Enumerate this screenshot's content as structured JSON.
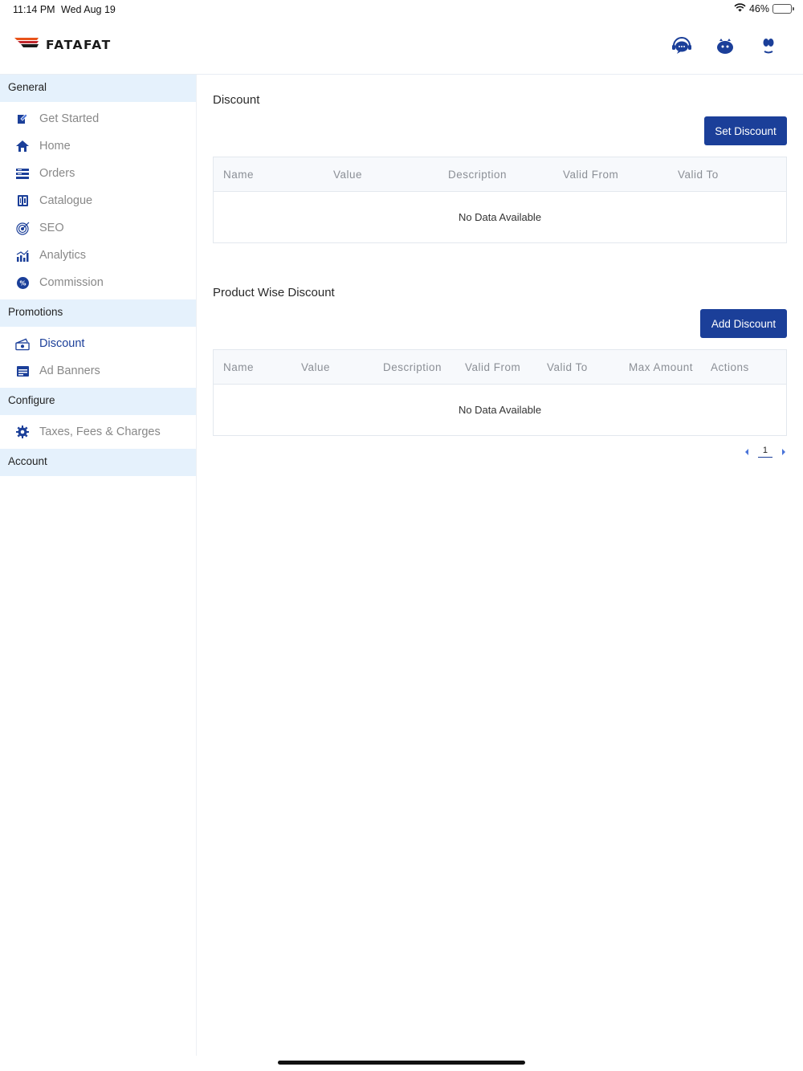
{
  "status_bar": {
    "time": "11:14 PM",
    "date": "Wed Aug 19",
    "battery": "46%",
    "battery_level": 0.46
  },
  "header": {
    "logo_text": "FATAFAT",
    "icons": [
      "chat-support-icon",
      "bot-icon",
      "user-icon"
    ]
  },
  "sidebar": {
    "sections": [
      {
        "title": "General",
        "items": [
          {
            "label": "Get Started",
            "icon": "edit-icon"
          },
          {
            "label": "Home",
            "icon": "home-icon"
          },
          {
            "label": "Orders",
            "icon": "orders-icon"
          },
          {
            "label": "Catalogue",
            "icon": "catalogue-icon"
          },
          {
            "label": "SEO",
            "icon": "target-icon"
          },
          {
            "label": "Analytics",
            "icon": "analytics-icon"
          },
          {
            "label": "Commission",
            "icon": "percent-icon"
          }
        ]
      },
      {
        "title": "Promotions",
        "items": [
          {
            "label": "Discount",
            "icon": "discount-icon",
            "active": true
          },
          {
            "label": "Ad Banners",
            "icon": "banner-icon"
          }
        ]
      },
      {
        "title": "Configure",
        "items": [
          {
            "label": "Taxes, Fees & Charges",
            "icon": "settings-gear-icon"
          }
        ]
      },
      {
        "title": "Account",
        "items": []
      }
    ]
  },
  "discount": {
    "title": "Discount",
    "button": "Set Discount",
    "columns": [
      "Name",
      "Value",
      "Description",
      "Valid From",
      "Valid To"
    ],
    "empty_text": "No Data Available"
  },
  "product_discount": {
    "title": "Product Wise Discount",
    "button": "Add Discount",
    "columns": [
      "Name",
      "Value",
      "Description",
      "Valid From",
      "Valid To",
      "Max Amount",
      "Actions"
    ],
    "empty_text": "No Data Available"
  },
  "pagination": {
    "current": "1"
  },
  "colors": {
    "primary": "#1b3f99",
    "section_bg": "#e5f1fc",
    "table_header_bg": "#f7f9fc"
  }
}
